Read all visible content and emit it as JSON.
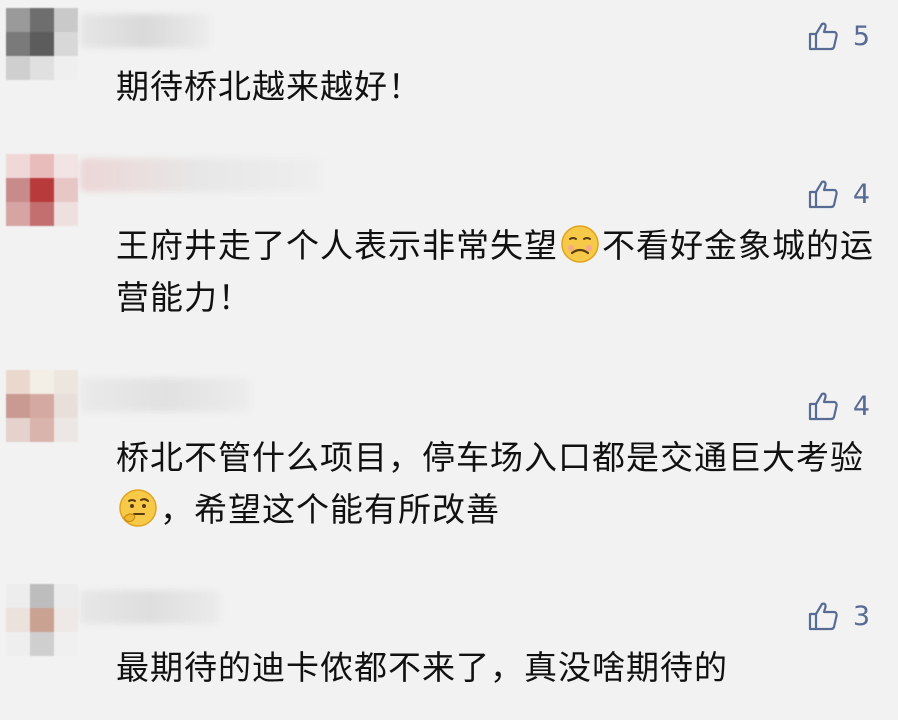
{
  "colors": {
    "background": "#f2f2f2",
    "like_blue": "#576b95",
    "text": "#111111"
  },
  "comments": [
    {
      "likes": "5",
      "text": "期待桥北越来越好！",
      "avatar_icon": "pixelated-avatar-icon"
    },
    {
      "likes": "4",
      "text_part1": "王府井走了个人表示非常失望",
      "emoji": "anguished-face-emoji-icon",
      "text_part2": "不看好金象城的运营能力！"
    },
    {
      "likes": "4",
      "text_part1": "桥北不管什么项目，停车场入口都是交通巨大考验",
      "emoji": "thinking-face-emoji-icon",
      "text_part2": "，希望这个能有所改善"
    },
    {
      "likes": "3",
      "text": "最期待的迪卡侬都不来了，真没啥期待的"
    }
  ],
  "like_icon": "thumbs-up-icon"
}
